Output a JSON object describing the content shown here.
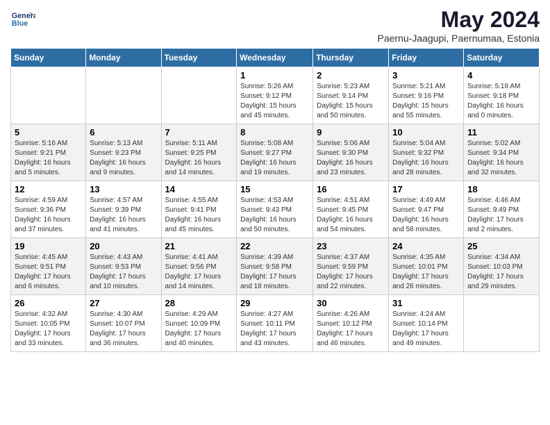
{
  "header": {
    "logo_line1": "General",
    "logo_line2": "Blue",
    "main_title": "May 2024",
    "subtitle": "Paernu-Jaagupi, Paernumaa, Estonia"
  },
  "days_of_week": [
    "Sunday",
    "Monday",
    "Tuesday",
    "Wednesday",
    "Thursday",
    "Friday",
    "Saturday"
  ],
  "weeks": [
    [
      {
        "day": "",
        "info": ""
      },
      {
        "day": "",
        "info": ""
      },
      {
        "day": "",
        "info": ""
      },
      {
        "day": "1",
        "info": "Sunrise: 5:26 AM\nSunset: 9:12 PM\nDaylight: 15 hours and 45 minutes."
      },
      {
        "day": "2",
        "info": "Sunrise: 5:23 AM\nSunset: 9:14 PM\nDaylight: 15 hours and 50 minutes."
      },
      {
        "day": "3",
        "info": "Sunrise: 5:21 AM\nSunset: 9:16 PM\nDaylight: 15 hours and 55 minutes."
      },
      {
        "day": "4",
        "info": "Sunrise: 5:18 AM\nSunset: 9:18 PM\nDaylight: 16 hours and 0 minutes."
      }
    ],
    [
      {
        "day": "5",
        "info": "Sunrise: 5:16 AM\nSunset: 9:21 PM\nDaylight: 16 hours and 5 minutes."
      },
      {
        "day": "6",
        "info": "Sunrise: 5:13 AM\nSunset: 9:23 PM\nDaylight: 16 hours and 9 minutes."
      },
      {
        "day": "7",
        "info": "Sunrise: 5:11 AM\nSunset: 9:25 PM\nDaylight: 16 hours and 14 minutes."
      },
      {
        "day": "8",
        "info": "Sunrise: 5:08 AM\nSunset: 9:27 PM\nDaylight: 16 hours and 19 minutes."
      },
      {
        "day": "9",
        "info": "Sunrise: 5:06 AM\nSunset: 9:30 PM\nDaylight: 16 hours and 23 minutes."
      },
      {
        "day": "10",
        "info": "Sunrise: 5:04 AM\nSunset: 9:32 PM\nDaylight: 16 hours and 28 minutes."
      },
      {
        "day": "11",
        "info": "Sunrise: 5:02 AM\nSunset: 9:34 PM\nDaylight: 16 hours and 32 minutes."
      }
    ],
    [
      {
        "day": "12",
        "info": "Sunrise: 4:59 AM\nSunset: 9:36 PM\nDaylight: 16 hours and 37 minutes."
      },
      {
        "day": "13",
        "info": "Sunrise: 4:57 AM\nSunset: 9:39 PM\nDaylight: 16 hours and 41 minutes."
      },
      {
        "day": "14",
        "info": "Sunrise: 4:55 AM\nSunset: 9:41 PM\nDaylight: 16 hours and 45 minutes."
      },
      {
        "day": "15",
        "info": "Sunrise: 4:53 AM\nSunset: 9:43 PM\nDaylight: 16 hours and 50 minutes."
      },
      {
        "day": "16",
        "info": "Sunrise: 4:51 AM\nSunset: 9:45 PM\nDaylight: 16 hours and 54 minutes."
      },
      {
        "day": "17",
        "info": "Sunrise: 4:49 AM\nSunset: 9:47 PM\nDaylight: 16 hours and 58 minutes."
      },
      {
        "day": "18",
        "info": "Sunrise: 4:46 AM\nSunset: 9:49 PM\nDaylight: 17 hours and 2 minutes."
      }
    ],
    [
      {
        "day": "19",
        "info": "Sunrise: 4:45 AM\nSunset: 9:51 PM\nDaylight: 17 hours and 6 minutes."
      },
      {
        "day": "20",
        "info": "Sunrise: 4:43 AM\nSunset: 9:53 PM\nDaylight: 17 hours and 10 minutes."
      },
      {
        "day": "21",
        "info": "Sunrise: 4:41 AM\nSunset: 9:56 PM\nDaylight: 17 hours and 14 minutes."
      },
      {
        "day": "22",
        "info": "Sunrise: 4:39 AM\nSunset: 9:58 PM\nDaylight: 17 hours and 18 minutes."
      },
      {
        "day": "23",
        "info": "Sunrise: 4:37 AM\nSunset: 9:59 PM\nDaylight: 17 hours and 22 minutes."
      },
      {
        "day": "24",
        "info": "Sunrise: 4:35 AM\nSunset: 10:01 PM\nDaylight: 17 hours and 26 minutes."
      },
      {
        "day": "25",
        "info": "Sunrise: 4:34 AM\nSunset: 10:03 PM\nDaylight: 17 hours and 29 minutes."
      }
    ],
    [
      {
        "day": "26",
        "info": "Sunrise: 4:32 AM\nSunset: 10:05 PM\nDaylight: 17 hours and 33 minutes."
      },
      {
        "day": "27",
        "info": "Sunrise: 4:30 AM\nSunset: 10:07 PM\nDaylight: 17 hours and 36 minutes."
      },
      {
        "day": "28",
        "info": "Sunrise: 4:29 AM\nSunset: 10:09 PM\nDaylight: 17 hours and 40 minutes."
      },
      {
        "day": "29",
        "info": "Sunrise: 4:27 AM\nSunset: 10:11 PM\nDaylight: 17 hours and 43 minutes."
      },
      {
        "day": "30",
        "info": "Sunrise: 4:26 AM\nSunset: 10:12 PM\nDaylight: 17 hours and 46 minutes."
      },
      {
        "day": "31",
        "info": "Sunrise: 4:24 AM\nSunset: 10:14 PM\nDaylight: 17 hours and 49 minutes."
      },
      {
        "day": "",
        "info": ""
      }
    ]
  ]
}
